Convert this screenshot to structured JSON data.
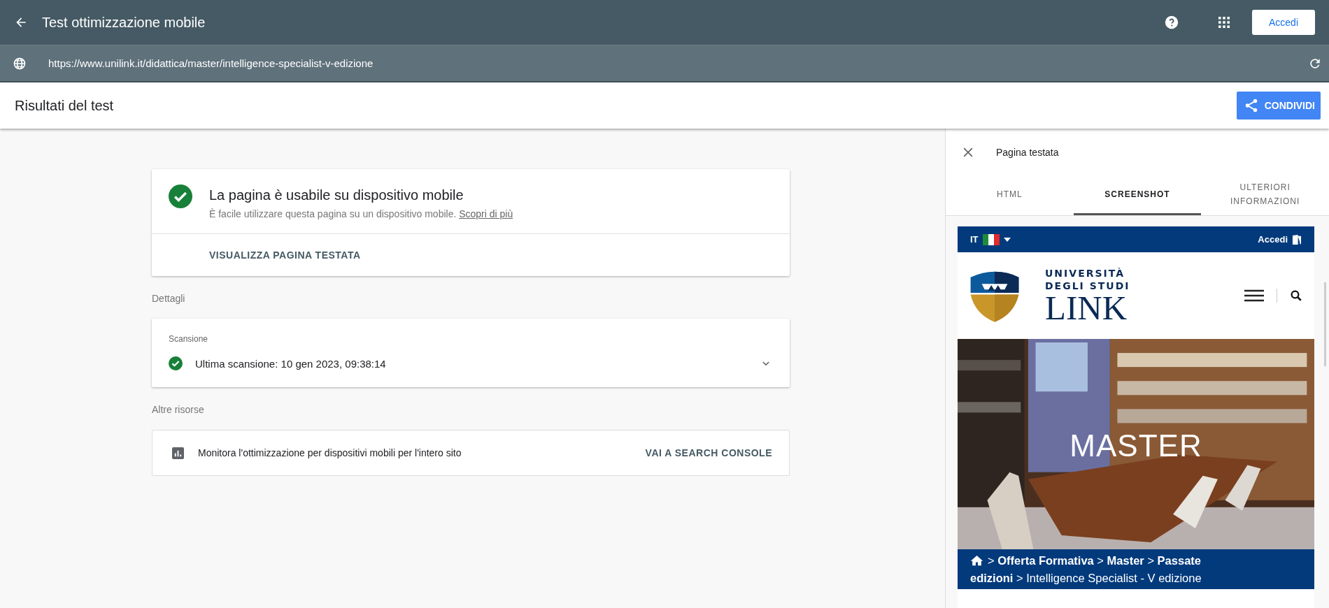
{
  "app_bar": {
    "title": "Test ottimizzazione mobile",
    "sign_in_button": "Accedi"
  },
  "url_bar": {
    "value": "https://www.unilink.it/didattica/master/intelligence-specialist-v-edizione"
  },
  "results_header": {
    "title": "Risultati del test",
    "share_button": "CONDIVIDI"
  },
  "verdict": {
    "passed": true,
    "title": "La pagina è usabile su dispositivo mobile",
    "description": "È facile utilizzare questa pagina su un dispositivo mobile.",
    "link": "Scopri di più",
    "action": "VISUALIZZA PAGINA TESTATA"
  },
  "details": {
    "heading": "Dettagli",
    "card_title": "Scansione",
    "crawl_passed": true,
    "crawl": "Ultima scansione: 10 gen 2023, 09:38:14",
    "expanded": false
  },
  "other_resources": {
    "heading": "Altre risorse",
    "text": "Monitora l'ottimizzazione per dispositivi mobili per l'intero sito",
    "link": "VAI A SEARCH CONSOLE"
  },
  "panel": {
    "title": "Pagina testata",
    "tabs": [
      {
        "label": "HTML",
        "selected": false
      },
      {
        "label": "SCREENSHOT",
        "selected": true
      },
      {
        "label": "ULTERIORI INFORMAZIONI",
        "selected": false
      }
    ],
    "preview": {
      "language": "IT",
      "sign_in": "Accedi",
      "logo_lines": [
        "UNIVERSITÀ",
        "DEGLI STUDI",
        "LINK"
      ],
      "hero_title": "MASTER",
      "breadcrumb_lines": [
        "> **Offerta Formativa** > **Master** > **Passate**",
        "**edizioni** > Intelligence Specialist - V edizione"
      ]
    }
  }
}
